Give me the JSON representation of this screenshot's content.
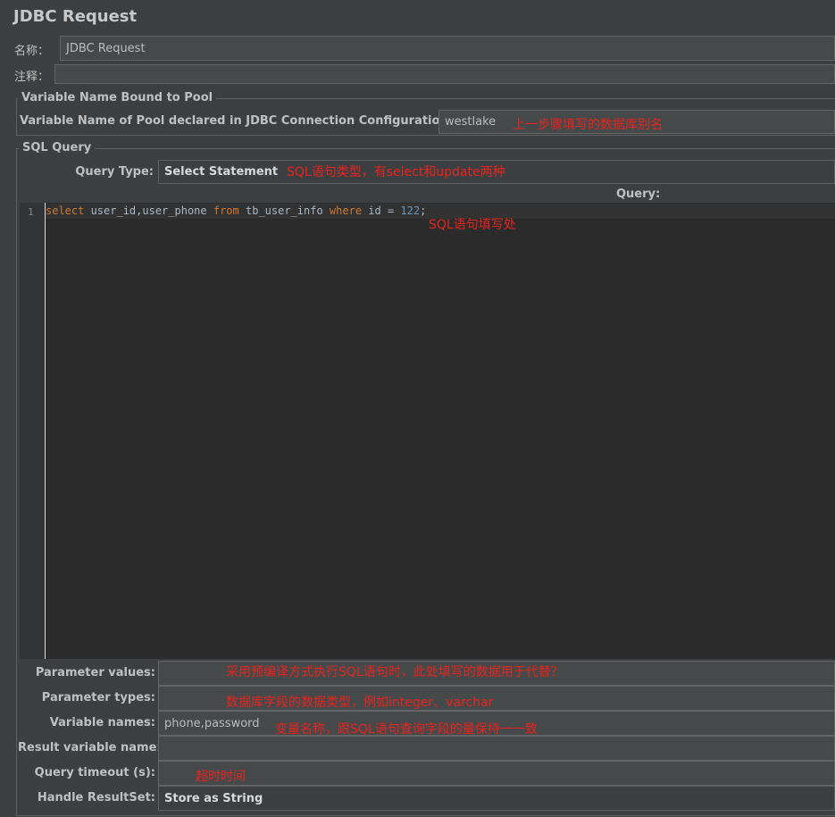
{
  "header": {
    "title": "JDBC Request"
  },
  "name_row": {
    "label": "名称：",
    "value": "JDBC Request"
  },
  "comment_row": {
    "label": "注释：",
    "value": ""
  },
  "pool_group": {
    "title": "Variable Name Bound to Pool",
    "label": "Variable Name of Pool declared in JDBC Connection Configuration:",
    "value": "westlake",
    "note": "上一步骤填写的数据库别名"
  },
  "sql_group": {
    "title": "SQL Query",
    "query_type_label": "Query Type:",
    "query_type_value": "Select Statement",
    "query_type_note": "SQL语句类型，有select和update两种",
    "query_label": "Query:",
    "editor": {
      "line_number": "1",
      "kw_select": "select",
      "fields": " user_id,user_phone ",
      "kw_from": "from",
      "table": " tb_user_info ",
      "kw_where": "where",
      "condition": " id = ",
      "number": "122",
      "end": ";",
      "note": "SQL语句填写处"
    }
  },
  "params": {
    "values": {
      "label": "Parameter values:",
      "value": "",
      "note": "采用预编译方式执行SQL语句时，此处填写的数据用于代替？"
    },
    "types": {
      "label": "Parameter types:",
      "value": "",
      "note": "数据库字段的数据类型，例如integer、varchar"
    },
    "var_names": {
      "label": "Variable names:",
      "value": "phone,password",
      "note": "变量名称，跟SQL语句查询字段的量保持一一致"
    },
    "result_var": {
      "label": "Result variable name:",
      "value": ""
    },
    "timeout": {
      "label": "Query timeout (s):",
      "value": "",
      "note": "超时时间"
    },
    "resultset": {
      "label": "Handle ResultSet:",
      "value": "Store as String"
    }
  }
}
